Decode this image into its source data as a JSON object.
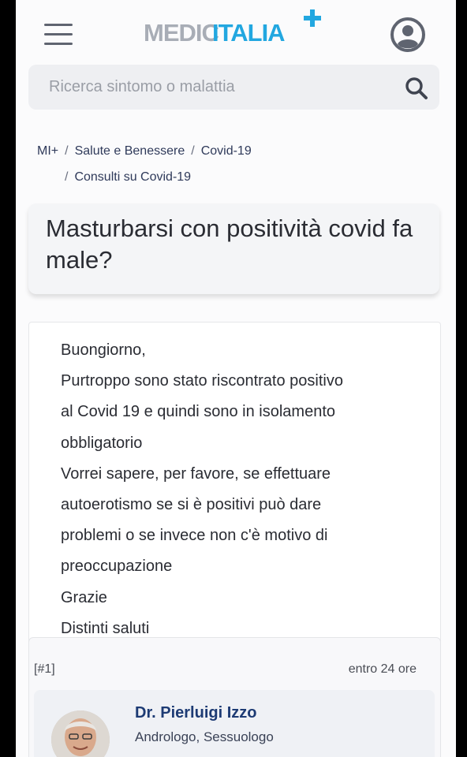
{
  "header": {
    "logo_part1": "MEDIC",
    "logo_part2": "ITALIA",
    "menu_icon": "hamburger-icon",
    "account_icon": "user-icon",
    "brand_colors": {
      "grey": "#a8adb6",
      "blue": "#22a7e0"
    }
  },
  "search": {
    "placeholder": "Ricerca sintomo o malattia",
    "value": "",
    "icon": "search-icon"
  },
  "breadcrumb": {
    "separator": "/",
    "items": [
      "MI+",
      "Salute e Benessere",
      "Covid-19",
      "Consulti su Covid-19"
    ]
  },
  "title": "Masturbarsi con positività covid fa male?",
  "question": {
    "lines": [
      "Buongiorno,",
      "Purtroppo sono stato riscontrato positivo",
      "al Covid 19 e quindi sono in isolamento",
      "obbligatorio",
      "Vorrei sapere, per favore, se effettuare",
      "autoerotismo se si è positivi può dare",
      "problemi o se invece non c'è motivo di",
      "preoccupazione",
      "Grazie",
      "Distinti saluti"
    ]
  },
  "answer": {
    "number": "[#1]",
    "time": "entro 24 ore",
    "doctor_name": "Dr. Pierluigi Izzo",
    "doctor_specialty": "Andrologo, Sessuologo"
  }
}
